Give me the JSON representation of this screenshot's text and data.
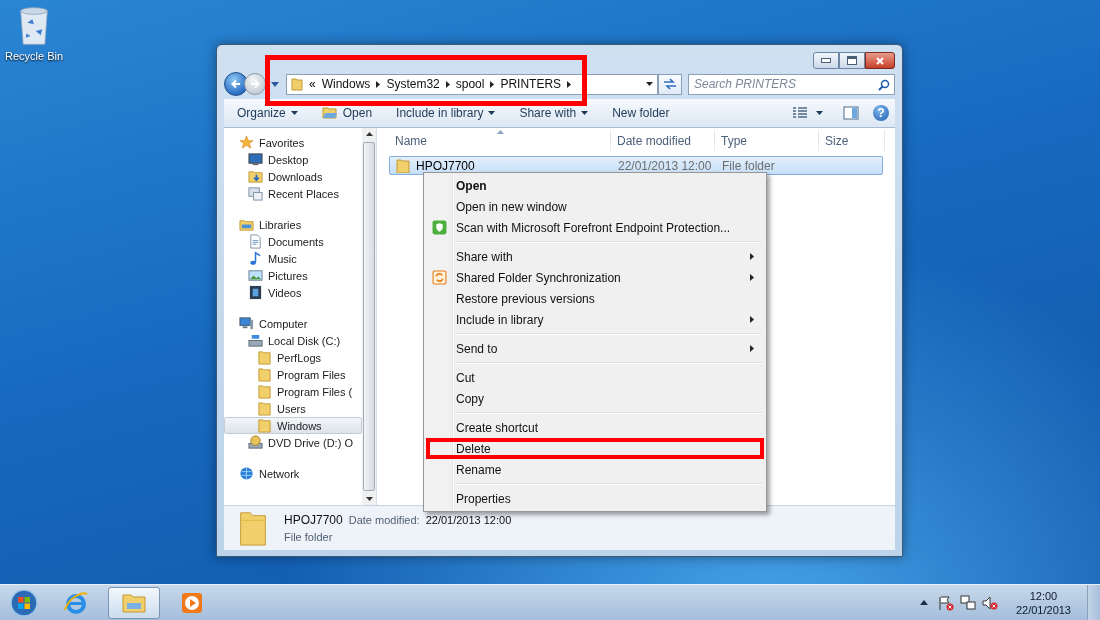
{
  "desktop": {
    "icons": [
      {
        "label": "Recycle Bin"
      }
    ]
  },
  "address": {
    "back": {
      "disabled": false
    },
    "forward": {
      "disabled": true
    },
    "overflow": "«",
    "crumbs": [
      "Windows",
      "System32",
      "spool",
      "PRINTERS"
    ],
    "highlighted": true
  },
  "search": {
    "placeholder": "Search PRINTERS"
  },
  "toolbar": {
    "buttons": [
      {
        "label": "Organize",
        "kind": "menu"
      },
      {
        "label": "Open",
        "kind": "icon"
      },
      {
        "label": "Include in library",
        "kind": "menu"
      },
      {
        "label": "Share with",
        "kind": "menu"
      },
      {
        "label": "New folder",
        "kind": "plain"
      }
    ],
    "help": "?"
  },
  "navigation": {
    "items": [
      {
        "label": "Favorites",
        "kind": "star",
        "selected": false,
        "children": [
          {
            "label": "Desktop",
            "kind": "desktop",
            "selected": false
          },
          {
            "label": "Downloads",
            "kind": "downloads",
            "selected": false
          },
          {
            "label": "Recent Places",
            "kind": "recent",
            "selected": false
          }
        ]
      },
      {
        "label": "Libraries",
        "kind": "library",
        "selected": false,
        "children": [
          {
            "label": "Documents",
            "kind": "document",
            "selected": false
          },
          {
            "label": "Music",
            "kind": "music",
            "selected": false
          },
          {
            "label": "Pictures",
            "kind": "pictures",
            "selected": false
          },
          {
            "label": "Videos",
            "kind": "videos",
            "selected": false
          }
        ]
      },
      {
        "label": "Computer",
        "kind": "computer",
        "selected": false,
        "children": [
          {
            "label": "Local Disk (C:)",
            "kind": "drive",
            "selected": false,
            "children": [
              {
                "label": "PerfLogs",
                "kind": "folder",
                "selected": false
              },
              {
                "label": "Program Files",
                "kind": "folder",
                "selected": false
              },
              {
                "label": "Program Files (",
                "kind": "folder",
                "selected": false
              },
              {
                "label": "Users",
                "kind": "folder",
                "selected": false
              },
              {
                "label": "Windows",
                "kind": "folder",
                "selected": true
              }
            ]
          },
          {
            "label": "DVD Drive (D:) O",
            "kind": "dvd",
            "selected": false
          }
        ]
      },
      {
        "label": "Network",
        "kind": "network",
        "selected": false
      }
    ]
  },
  "file_list": {
    "columns": [
      {
        "label": "Name",
        "sorted": true
      },
      {
        "label": "Date modified",
        "sorted": false
      },
      {
        "label": "Type",
        "sorted": false
      },
      {
        "label": "Size",
        "sorted": false
      }
    ],
    "rows": [
      {
        "name": "HPOJ7700",
        "date": "22/01/2013 12:00",
        "type": "File folder",
        "selected": true
      }
    ]
  },
  "context_menu": {
    "groups": [
      [
        {
          "label": "Open",
          "kind": "plain",
          "default": true,
          "submenu": false,
          "highlighted": false
        },
        {
          "label": "Open in new window",
          "kind": "plain",
          "default": false,
          "submenu": false,
          "highlighted": false
        },
        {
          "label": "Scan with Microsoft Forefront Endpoint Protection...",
          "kind": "shield",
          "default": false,
          "submenu": false,
          "highlighted": false
        }
      ],
      [
        {
          "label": "Share with",
          "kind": "plain",
          "default": false,
          "submenu": true,
          "highlighted": false
        },
        {
          "label": "Shared Folder Synchronization",
          "kind": "sync",
          "default": false,
          "submenu": true,
          "highlighted": false
        },
        {
          "label": "Restore previous versions",
          "kind": "plain",
          "default": false,
          "submenu": false,
          "highlighted": false
        },
        {
          "label": "Include in library",
          "kind": "plain",
          "default": false,
          "submenu": true,
          "highlighted": false
        }
      ],
      [
        {
          "label": "Send to",
          "kind": "plain",
          "default": false,
          "submenu": true,
          "highlighted": false
        }
      ],
      [
        {
          "label": "Cut",
          "kind": "plain",
          "default": false,
          "submenu": false,
          "highlighted": false
        },
        {
          "label": "Copy",
          "kind": "plain",
          "default": false,
          "submenu": false,
          "highlighted": false
        }
      ],
      [
        {
          "label": "Create shortcut",
          "kind": "plain",
          "default": false,
          "submenu": false,
          "highlighted": false
        },
        {
          "label": "Delete",
          "kind": "plain",
          "default": false,
          "submenu": false,
          "highlighted": true
        },
        {
          "label": "Rename",
          "kind": "plain",
          "default": false,
          "submenu": false,
          "highlighted": false
        }
      ],
      [
        {
          "label": "Properties",
          "kind": "plain",
          "default": false,
          "submenu": false,
          "highlighted": false
        }
      ]
    ]
  },
  "details": {
    "name": "HPOJ7700",
    "date_label": "Date modified:",
    "date": "22/01/2013 12:00",
    "type": "File folder"
  },
  "taskbar": {
    "apps": [
      {
        "kind": "browser",
        "active": false
      },
      {
        "kind": "explorer",
        "active": true
      },
      {
        "kind": "media",
        "active": false
      }
    ],
    "clock": {
      "time": "12:00",
      "date": "22/01/2013"
    }
  }
}
